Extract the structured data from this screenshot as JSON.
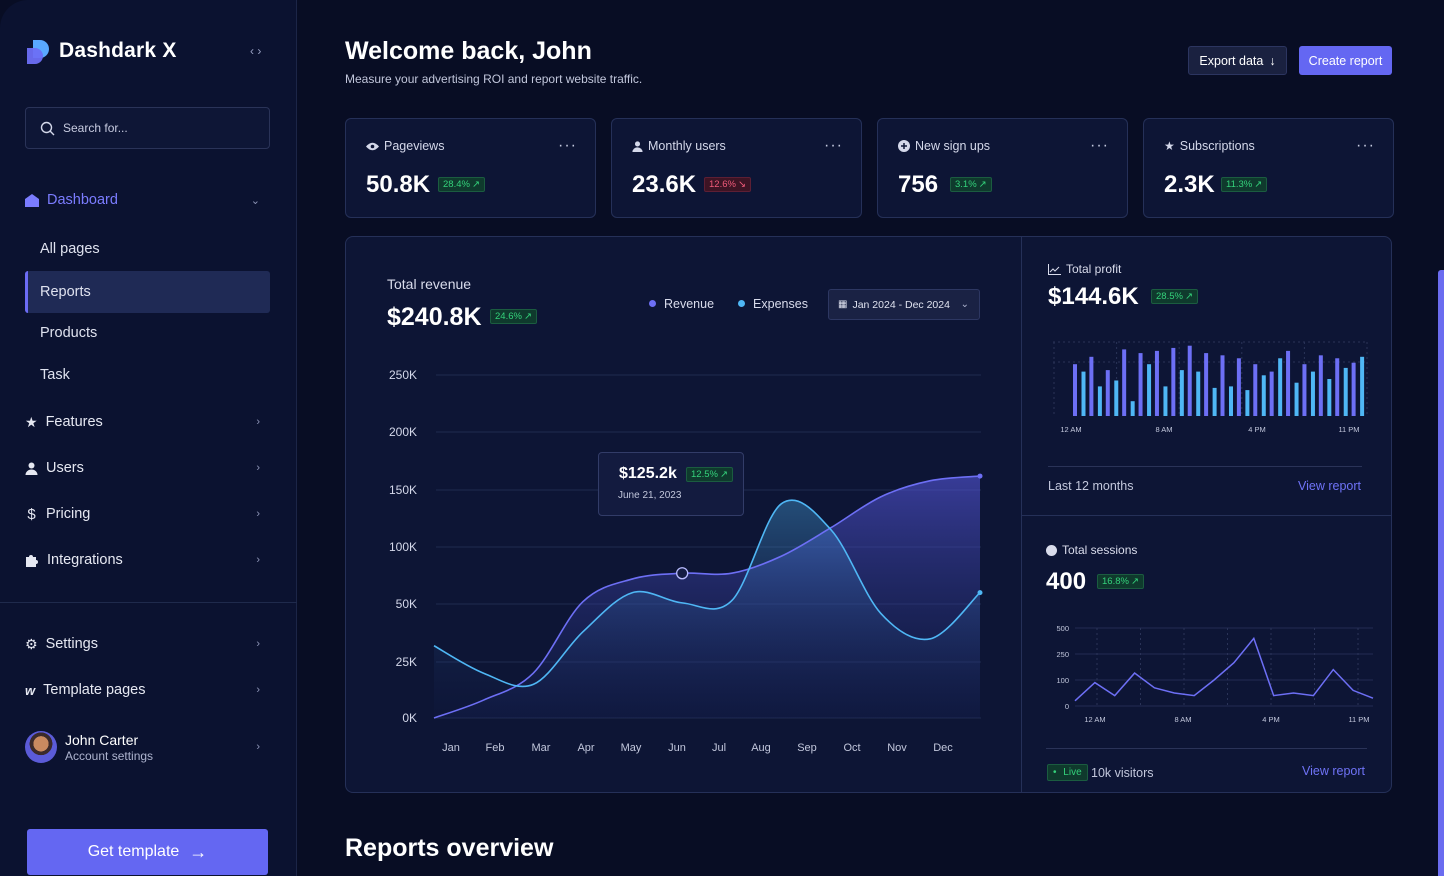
{
  "sidebar": {
    "brand": "Dashdark X",
    "search_placeholder": "Search for...",
    "dashboard_label": "Dashboard",
    "sub_items": [
      "All pages",
      "Reports",
      "Products",
      "Task"
    ],
    "items": [
      {
        "label": "Features",
        "icon": "star-icon"
      },
      {
        "label": "Users",
        "icon": "user-icon"
      },
      {
        "label": "Pricing",
        "icon": "dollar-icon"
      },
      {
        "label": "Integrations",
        "icon": "puzzle-icon"
      }
    ],
    "bottom_items": [
      {
        "label": "Settings",
        "icon": "gear-icon"
      },
      {
        "label": "Template pages",
        "icon": "webflow-icon"
      }
    ],
    "user": {
      "name": "John Carter",
      "subtitle": "Account settings"
    },
    "cta": "Get template"
  },
  "header": {
    "title": "Welcome back, John",
    "subtitle": "Measure your advertising ROI and report website traffic.",
    "export_label": "Export data",
    "create_label": "Create report"
  },
  "stats": [
    {
      "label": "Pageviews",
      "value": "50.8K",
      "change": "28.4%",
      "direction": "up",
      "icon": "eye-icon"
    },
    {
      "label": "Monthly users",
      "value": "23.6K",
      "change": "12.6%",
      "direction": "down",
      "icon": "user-icon"
    },
    {
      "label": "New sign ups",
      "value": "756",
      "change": "3.1%",
      "direction": "up",
      "icon": "plus-circle-icon"
    },
    {
      "label": "Subscriptions",
      "value": "2.3K",
      "change": "11.3%",
      "direction": "up",
      "icon": "star-icon"
    }
  ],
  "revenue": {
    "label": "Total revenue",
    "value": "$240.8K",
    "change": "24.6%",
    "legend": [
      {
        "name": "Revenue",
        "color": "#6d6ff5"
      },
      {
        "name": "Expenses",
        "color": "#4fb7f5"
      }
    ],
    "date_range": "Jan 2024 - Dec 2024",
    "tooltip": {
      "value": "$125.2k",
      "change": "12.5%",
      "date": "June 21, 2023"
    }
  },
  "profit": {
    "label": "Total profit",
    "value": "$144.6K",
    "change": "28.5%",
    "x_ticks": [
      "12 AM",
      "8 AM",
      "4 PM",
      "11 PM"
    ],
    "footer": "Last 12 months",
    "link": "View report"
  },
  "sessions": {
    "label": "Total sessions",
    "value": "400",
    "change": "16.8%",
    "y_ticks": [
      "500",
      "250",
      "100",
      "0"
    ],
    "x_ticks": [
      "12 AM",
      "8 AM",
      "4 PM",
      "11 PM"
    ],
    "live": "Live",
    "visitors": "10k visitors",
    "link": "View report"
  },
  "reports_overview": "Reports overview",
  "chart_data": [
    {
      "type": "area",
      "title": "Total revenue",
      "categories": [
        "Jan",
        "Feb",
        "Mar",
        "Apr",
        "May",
        "Jun",
        "Jul",
        "Aug",
        "Sep",
        "Oct",
        "Nov",
        "Dec"
      ],
      "y_ticks": [
        "250K",
        "200K",
        "150K",
        "100K",
        "50K",
        "25K",
        "0K"
      ],
      "series": [
        {
          "name": "Revenue",
          "color": "#6d6ff5",
          "values": [
            0,
            8,
            20,
            52,
            72,
            77,
            77,
            92,
            117,
            144,
            158,
            162
          ]
        },
        {
          "name": "Expenses",
          "color": "#4fb7f5",
          "values": [
            32,
            20,
            15,
            38,
            60,
            51,
            53,
            138,
            115,
            46,
            35,
            60
          ]
        }
      ]
    },
    {
      "type": "bar",
      "title": "Total profit",
      "x_ticks": [
        "12 AM",
        "8 AM",
        "4 PM",
        "11 PM"
      ],
      "series": [
        {
          "name": "",
          "color": "#6d6ff5",
          "values": [
            70,
            80,
            62,
            90,
            85,
            88,
            92,
            95,
            85,
            82,
            78,
            70,
            60,
            88,
            70,
            82,
            78,
            72
          ]
        },
        {
          "name": "",
          "color": "#4fb7f5",
          "values": [
            60,
            40,
            48,
            20,
            70,
            40,
            62,
            60,
            38,
            40,
            35,
            55,
            78,
            45,
            60,
            50,
            65,
            80
          ]
        }
      ]
    },
    {
      "type": "line",
      "title": "Total sessions",
      "x_ticks": [
        "12 AM",
        "8 AM",
        "4 PM",
        "11 PM"
      ],
      "y_ticks": [
        "500",
        "250",
        "100",
        "0"
      ],
      "values": [
        20,
        90,
        40,
        140,
        70,
        50,
        40,
        100,
        200,
        400,
        40,
        50,
        40,
        160,
        60,
        30
      ]
    }
  ]
}
